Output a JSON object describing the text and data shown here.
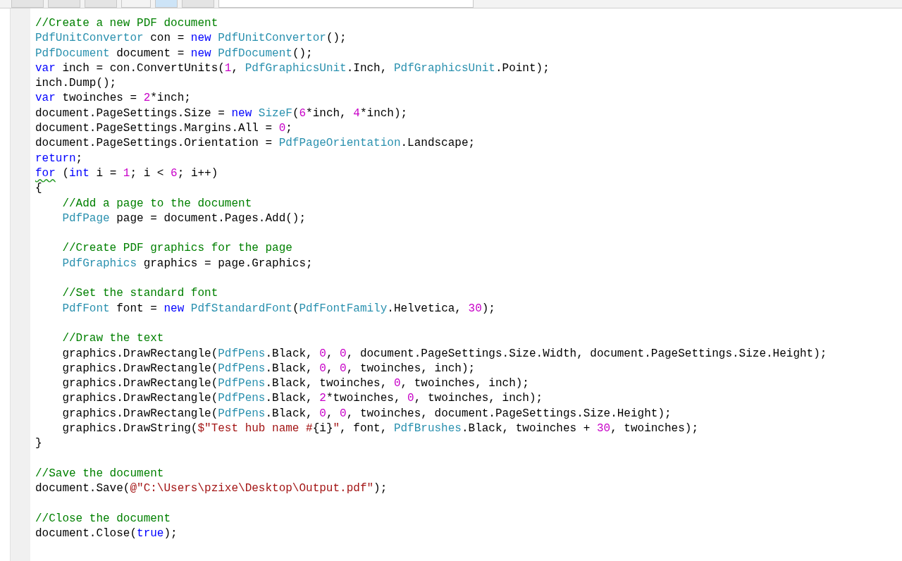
{
  "toolbar": {
    "buttons": [
      {
        "kind": "plain"
      },
      {
        "kind": "plain"
      },
      {
        "kind": "plain"
      },
      {
        "kind": "glyph"
      },
      {
        "kind": "selected"
      },
      {
        "kind": "plain"
      },
      {
        "kind": "field"
      }
    ]
  },
  "blocks": [
    {
      "lines": [
        {
          "tokens": [
            {
              "kind": "comment",
              "text": "//Create a new PDF document"
            }
          ]
        },
        {
          "tokens": [
            {
              "kind": "type",
              "text": "PdfUnitConvertor"
            },
            {
              "kind": "plain",
              "text": " con = "
            },
            {
              "kind": "keyword",
              "text": "new "
            },
            {
              "kind": "type",
              "text": "PdfUnitConvertor"
            },
            {
              "kind": "plain",
              "text": "();"
            }
          ]
        },
        {
          "tokens": [
            {
              "kind": "type",
              "text": "PdfDocument"
            },
            {
              "kind": "plain",
              "text": " document = "
            },
            {
              "kind": "keyword",
              "text": "new "
            },
            {
              "kind": "type",
              "text": "PdfDocument"
            },
            {
              "kind": "plain",
              "text": "();"
            }
          ]
        },
        {
          "tokens": [
            {
              "kind": "keyword",
              "text": "var"
            },
            {
              "kind": "plain",
              "text": " inch = con.ConvertUnits("
            },
            {
              "kind": "number",
              "text": "1"
            },
            {
              "kind": "plain",
              "text": ", "
            },
            {
              "kind": "type",
              "text": "PdfGraphicsUnit"
            },
            {
              "kind": "plain",
              "text": ".Inch, "
            },
            {
              "kind": "type",
              "text": "PdfGraphicsUnit"
            },
            {
              "kind": "plain",
              "text": ".Point);"
            }
          ]
        },
        {
          "tokens": [
            {
              "kind": "plain",
              "text": "inch.Dump();"
            }
          ]
        },
        {
          "tokens": [
            {
              "kind": "keyword",
              "text": "var"
            },
            {
              "kind": "plain",
              "text": " twoinches = "
            },
            {
              "kind": "number",
              "text": "2"
            },
            {
              "kind": "plain",
              "text": "*inch;"
            }
          ]
        },
        {
          "tokens": [
            {
              "kind": "plain",
              "text": "document.PageSettings.Size = "
            },
            {
              "kind": "keyword",
              "text": "new "
            },
            {
              "kind": "type",
              "text": "SizeF"
            },
            {
              "kind": "plain",
              "text": "("
            },
            {
              "kind": "number",
              "text": "6"
            },
            {
              "kind": "plain",
              "text": "*inch, "
            },
            {
              "kind": "number",
              "text": "4"
            },
            {
              "kind": "plain",
              "text": "*inch);"
            }
          ]
        },
        {
          "tokens": [
            {
              "kind": "plain",
              "text": "document.PageSettings.Margins.All = "
            },
            {
              "kind": "number",
              "text": "0"
            },
            {
              "kind": "plain",
              "text": ";"
            }
          ]
        },
        {
          "tokens": [
            {
              "kind": "plain",
              "text": "document.PageSettings.Orientation = "
            },
            {
              "kind": "type",
              "text": "PdfPageOrientation"
            },
            {
              "kind": "plain",
              "text": ".Landscape;"
            }
          ]
        },
        {
          "tokens": [
            {
              "kind": "keyword",
              "text": "return"
            },
            {
              "kind": "plain",
              "text": ";"
            }
          ]
        },
        {
          "tokens": [
            {
              "kind": "keyword",
              "text": "for",
              "warning": true
            },
            {
              "kind": "plain",
              "text": " ("
            },
            {
              "kind": "keyword",
              "text": "int"
            },
            {
              "kind": "plain",
              "text": " i = "
            },
            {
              "kind": "number",
              "text": "1"
            },
            {
              "kind": "plain",
              "text": "; i < "
            },
            {
              "kind": "number",
              "text": "6"
            },
            {
              "kind": "plain",
              "text": "; i++)"
            }
          ]
        },
        {
          "tokens": [
            {
              "kind": "plain",
              "text": "{"
            }
          ]
        },
        {
          "tokens": [
            {
              "kind": "comment",
              "text": "    //Add a page to the document"
            }
          ]
        },
        {
          "tokens": [
            {
              "kind": "type",
              "text": "    PdfPage"
            },
            {
              "kind": "plain",
              "text": " page = document.Pages.Add();"
            }
          ]
        }
      ]
    },
    {
      "lines": [
        {
          "tokens": [
            {
              "kind": "comment",
              "text": "    //Create PDF graphics for the page"
            }
          ]
        },
        {
          "tokens": [
            {
              "kind": "type",
              "text": "    PdfGraphics"
            },
            {
              "kind": "plain",
              "text": " graphics = page.Graphics;"
            }
          ]
        }
      ]
    },
    {
      "lines": [
        {
          "tokens": [
            {
              "kind": "comment",
              "text": "    //Set the standard font"
            }
          ]
        },
        {
          "tokens": [
            {
              "kind": "type",
              "text": "    PdfFont"
            },
            {
              "kind": "plain",
              "text": " font = "
            },
            {
              "kind": "keyword",
              "text": "new "
            },
            {
              "kind": "type",
              "text": "PdfStandardFont"
            },
            {
              "kind": "plain",
              "text": "("
            },
            {
              "kind": "type",
              "text": "PdfFontFamily"
            },
            {
              "kind": "plain",
              "text": ".Helvetica, "
            },
            {
              "kind": "number",
              "text": "30"
            },
            {
              "kind": "plain",
              "text": ");"
            }
          ]
        }
      ]
    },
    {
      "lines": [
        {
          "tokens": [
            {
              "kind": "comment",
              "text": "    //Draw the text"
            }
          ]
        },
        {
          "tokens": [
            {
              "kind": "plain",
              "text": "    graphics.DrawRectangle("
            },
            {
              "kind": "type",
              "text": "PdfPens"
            },
            {
              "kind": "plain",
              "text": ".Black, "
            },
            {
              "kind": "number",
              "text": "0"
            },
            {
              "kind": "plain",
              "text": ", "
            },
            {
              "kind": "number",
              "text": "0"
            },
            {
              "kind": "plain",
              "text": ", document.PageSettings.Size.Width, document.PageSettings.Size.Height);"
            }
          ]
        },
        {
          "tokens": [
            {
              "kind": "plain",
              "text": "    graphics.DrawRectangle("
            },
            {
              "kind": "type",
              "text": "PdfPens"
            },
            {
              "kind": "plain",
              "text": ".Black, "
            },
            {
              "kind": "number",
              "text": "0"
            },
            {
              "kind": "plain",
              "text": ", "
            },
            {
              "kind": "number",
              "text": "0"
            },
            {
              "kind": "plain",
              "text": ", twoinches, inch);"
            }
          ]
        },
        {
          "tokens": [
            {
              "kind": "plain",
              "text": "    graphics.DrawRectangle("
            },
            {
              "kind": "type",
              "text": "PdfPens"
            },
            {
              "kind": "plain",
              "text": ".Black, twoinches, "
            },
            {
              "kind": "number",
              "text": "0"
            },
            {
              "kind": "plain",
              "text": ", twoinches, inch);"
            }
          ]
        },
        {
          "tokens": [
            {
              "kind": "plain",
              "text": "    graphics.DrawRectangle("
            },
            {
              "kind": "type",
              "text": "PdfPens"
            },
            {
              "kind": "plain",
              "text": ".Black, "
            },
            {
              "kind": "number",
              "text": "2"
            },
            {
              "kind": "plain",
              "text": "*twoinches, "
            },
            {
              "kind": "number",
              "text": "0"
            },
            {
              "kind": "plain",
              "text": ", twoinches, inch);"
            }
          ]
        },
        {
          "tokens": [
            {
              "kind": "plain",
              "text": "    graphics.DrawRectangle("
            },
            {
              "kind": "type",
              "text": "PdfPens"
            },
            {
              "kind": "plain",
              "text": ".Black, "
            },
            {
              "kind": "number",
              "text": "0"
            },
            {
              "kind": "plain",
              "text": ", "
            },
            {
              "kind": "number",
              "text": "0"
            },
            {
              "kind": "plain",
              "text": ", twoinches, document.PageSettings.Size.Height);"
            }
          ]
        },
        {
          "tokens": [
            {
              "kind": "plain",
              "text": "    graphics.DrawString("
            },
            {
              "kind": "string",
              "text": "$\"Test hub name #"
            },
            {
              "kind": "plain",
              "text": "{i}"
            },
            {
              "kind": "string",
              "text": "\""
            },
            {
              "kind": "plain",
              "text": ", font, "
            },
            {
              "kind": "type",
              "text": "PdfBrushes"
            },
            {
              "kind": "plain",
              "text": ".Black, twoinches + "
            },
            {
              "kind": "number",
              "text": "30"
            },
            {
              "kind": "plain",
              "text": ", twoinches);"
            }
          ]
        },
        {
          "tokens": [
            {
              "kind": "plain",
              "text": "}"
            }
          ]
        }
      ]
    },
    {
      "lines": [
        {
          "tokens": [
            {
              "kind": "comment",
              "text": "//Save the document"
            }
          ]
        },
        {
          "tokens": [
            {
              "kind": "plain",
              "text": "document.Save("
            },
            {
              "kind": "string",
              "text": "@\"C:\\Users\\pzixe\\Desktop\\Output.pdf\""
            },
            {
              "kind": "plain",
              "text": ");"
            }
          ]
        }
      ]
    },
    {
      "lines": [
        {
          "tokens": [
            {
              "kind": "comment",
              "text": "//Close the document"
            }
          ]
        },
        {
          "tokens": [
            {
              "kind": "plain",
              "text": "document.Close("
            },
            {
              "kind": "keyword",
              "text": "true"
            },
            {
              "kind": "plain",
              "text": ");"
            }
          ]
        }
      ]
    }
  ]
}
